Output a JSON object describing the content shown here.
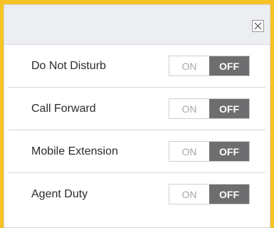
{
  "dialog": {
    "close_icon_label": "close",
    "rows": [
      {
        "label": "Do Not Disturb",
        "on": "ON",
        "off": "OFF",
        "state": "off"
      },
      {
        "label": "Call Forward",
        "on": "ON",
        "off": "OFF",
        "state": "off"
      },
      {
        "label": "Mobile Extension",
        "on": "ON",
        "off": "OFF",
        "state": "off"
      },
      {
        "label": "Agent Duty",
        "on": "ON",
        "off": "OFF",
        "state": "off"
      }
    ]
  },
  "colors": {
    "backdrop": "#f6c324",
    "header": "#eceef1",
    "toggle_active": "#6e6e70"
  }
}
